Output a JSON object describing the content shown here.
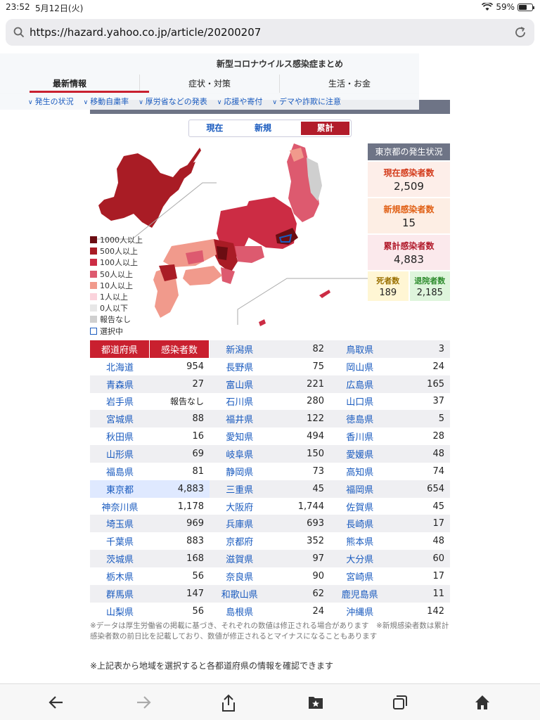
{
  "status": {
    "time": "23:52",
    "date": "5月12日(火)",
    "battery": "59%"
  },
  "browser": {
    "url": "https://hazard.yahoo.co.jp/article/20200207"
  },
  "header": {
    "title": "新型コロナウイルス感染症まとめ",
    "tabs": [
      "最新情報",
      "症状・対策",
      "生活・お金"
    ],
    "subnav": [
      "発生の状況",
      "移動自粛率",
      "厚労省などの発表",
      "応援や寄付",
      "デマや詐欺に注意"
    ]
  },
  "toggle": {
    "current": "現在",
    "new": "新規",
    "total": "累計",
    "selected": "累計"
  },
  "legend": [
    {
      "label": "1000人以上",
      "color": "#6b0d12"
    },
    {
      "label": "500人以上",
      "color": "#a91c25"
    },
    {
      "label": "100人以上",
      "color": "#cc2c44"
    },
    {
      "label": "50人以上",
      "color": "#dd5a6f"
    },
    {
      "label": "10人以上",
      "color": "#f19a8c"
    },
    {
      "label": "1人以上",
      "color": "#fbd3dc"
    },
    {
      "label": "0人以下",
      "color": "#e7e7e7"
    },
    {
      "label": "報告なし",
      "color": "#cfcfcf"
    },
    {
      "label": "選択中",
      "color": "#ffffff"
    }
  ],
  "tokyo": {
    "heading": "東京都の発生状況",
    "current_label": "現在感染者数",
    "current_value": "2,509",
    "new_label": "新規感染者数",
    "new_value": "15",
    "total_label": "累計感染者数",
    "total_value": "4,883",
    "deaths_label": "死者数",
    "deaths_value": "189",
    "recovered_label": "退院者数",
    "recovered_value": "2,185"
  },
  "table": {
    "head_pref": "都道府県",
    "head_count": "感染者数",
    "col1": [
      [
        "北海道",
        "954"
      ],
      [
        "青森県",
        "27"
      ],
      [
        "岩手県",
        "報告なし"
      ],
      [
        "宮城県",
        "88"
      ],
      [
        "秋田県",
        "16"
      ],
      [
        "山形県",
        "69"
      ],
      [
        "福島県",
        "81"
      ],
      [
        "東京都",
        "4,883"
      ],
      [
        "神奈川県",
        "1,178"
      ],
      [
        "埼玉県",
        "969"
      ],
      [
        "千葉県",
        "883"
      ],
      [
        "茨城県",
        "168"
      ],
      [
        "栃木県",
        "56"
      ],
      [
        "群馬県",
        "147"
      ],
      [
        "山梨県",
        "56"
      ]
    ],
    "col2": [
      [
        "新潟県",
        "82"
      ],
      [
        "長野県",
        "75"
      ],
      [
        "富山県",
        "221"
      ],
      [
        "石川県",
        "280"
      ],
      [
        "福井県",
        "122"
      ],
      [
        "愛知県",
        "494"
      ],
      [
        "岐阜県",
        "150"
      ],
      [
        "静岡県",
        "73"
      ],
      [
        "三重県",
        "45"
      ],
      [
        "大阪府",
        "1,744"
      ],
      [
        "兵庫県",
        "693"
      ],
      [
        "京都府",
        "352"
      ],
      [
        "滋賀県",
        "97"
      ],
      [
        "奈良県",
        "90"
      ],
      [
        "和歌山県",
        "62"
      ],
      [
        "島根県",
        "24"
      ]
    ],
    "col3": [
      [
        "鳥取県",
        "3"
      ],
      [
        "岡山県",
        "24"
      ],
      [
        "広島県",
        "165"
      ],
      [
        "山口県",
        "37"
      ],
      [
        "徳島県",
        "5"
      ],
      [
        "香川県",
        "28"
      ],
      [
        "愛媛県",
        "48"
      ],
      [
        "高知県",
        "74"
      ],
      [
        "福岡県",
        "654"
      ],
      [
        "佐賀県",
        "45"
      ],
      [
        "長崎県",
        "17"
      ],
      [
        "熊本県",
        "48"
      ],
      [
        "大分県",
        "60"
      ],
      [
        "宮崎県",
        "17"
      ],
      [
        "鹿児島県",
        "11"
      ],
      [
        "沖縄県",
        "142"
      ]
    ]
  },
  "notes": {
    "note1": "※データは厚生労働省の掲載に基づき、それぞれの数値は修正される場合があります　※新規感染者数は累計感染者数の前日比を記載しており、数値が修正されるとマイナスになることもあります",
    "note2": "※上記表から地域を選択すると各都道府県の情報を確認できます"
  },
  "icons": [
    "search-icon",
    "reload-icon",
    "wifi-icon",
    "back-icon",
    "forward-icon",
    "share-icon",
    "bookmarks-icon",
    "tabs-icon",
    "home-icon"
  ]
}
